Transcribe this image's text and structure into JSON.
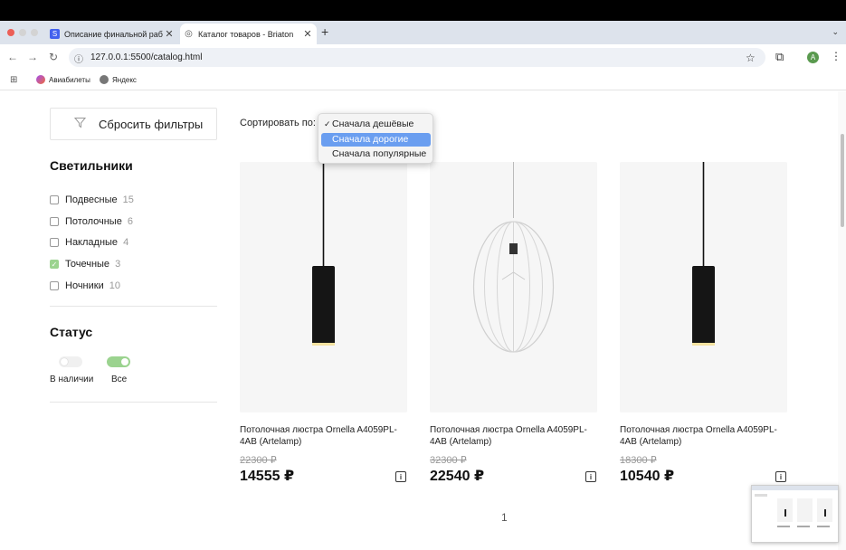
{
  "browser": {
    "tabs": [
      {
        "title": "Описание финальной работ",
        "favicon": "S",
        "active": false
      },
      {
        "title": "Каталог товаров - Briaton",
        "favicon": "globe-icon",
        "active": true
      }
    ],
    "url": "127.0.0.1:5500/catalog.html",
    "profile_initial": "A",
    "bookmarks": [
      "Авиабилеты",
      "Яндекс"
    ]
  },
  "sidebar": {
    "reset_label": "Сбросить фильтры",
    "categories_title": "Светильники",
    "categories": [
      {
        "label": "Подвесные",
        "count": "15",
        "checked": false
      },
      {
        "label": "Потолочные",
        "count": "6",
        "checked": false
      },
      {
        "label": "Накладные",
        "count": "4",
        "checked": false
      },
      {
        "label": "Точечные",
        "count": "3",
        "checked": true
      },
      {
        "label": "Ночники",
        "count": "10",
        "checked": false
      }
    ],
    "status_title": "Статус",
    "status_in_stock": "В наличии",
    "status_all": "Все"
  },
  "sort": {
    "label": "Сортировать по:",
    "options": [
      "Сначала дешёвые",
      "Сначала дорогие",
      "Сначала популярные"
    ],
    "checked_index": 0,
    "highlighted_index": 1
  },
  "products": [
    {
      "name": "Потолочная люстра Ornella A4059PL-4AB (Artelamp)",
      "old_price": "22300 ₽",
      "price": "14555 ₽"
    },
    {
      "name": "Потолочная люстра Ornella A4059PL-4AB (Artelamp)",
      "old_price": "32300 ₽",
      "price": "22540 ₽"
    },
    {
      "name": "Потолочная люстра Ornella A4059PL-4AB (Artelamp)",
      "old_price": "18300 ₽",
      "price": "10540 ₽"
    }
  ],
  "pagination": {
    "current": "1"
  },
  "colors": {
    "accent_green": "#9bd38f",
    "dropdown_highlight": "#6a9ef0"
  }
}
